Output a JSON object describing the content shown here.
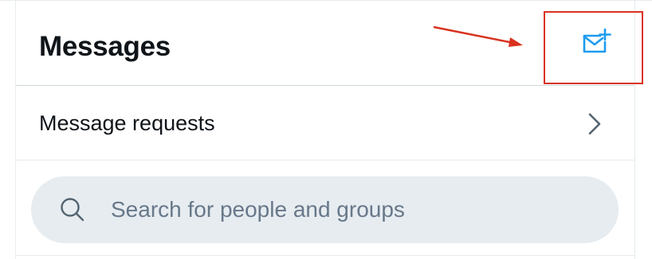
{
  "header": {
    "title": "Messages",
    "new_message_icon": "new-message-icon",
    "accent_color": "#1d9bf0"
  },
  "annotation": {
    "highlight_color": "#d9321f"
  },
  "message_requests": {
    "label": "Message requests",
    "icon": "chevron-right-icon"
  },
  "search": {
    "placeholder": "Search for people and groups",
    "value": "",
    "icon": "search-icon"
  }
}
